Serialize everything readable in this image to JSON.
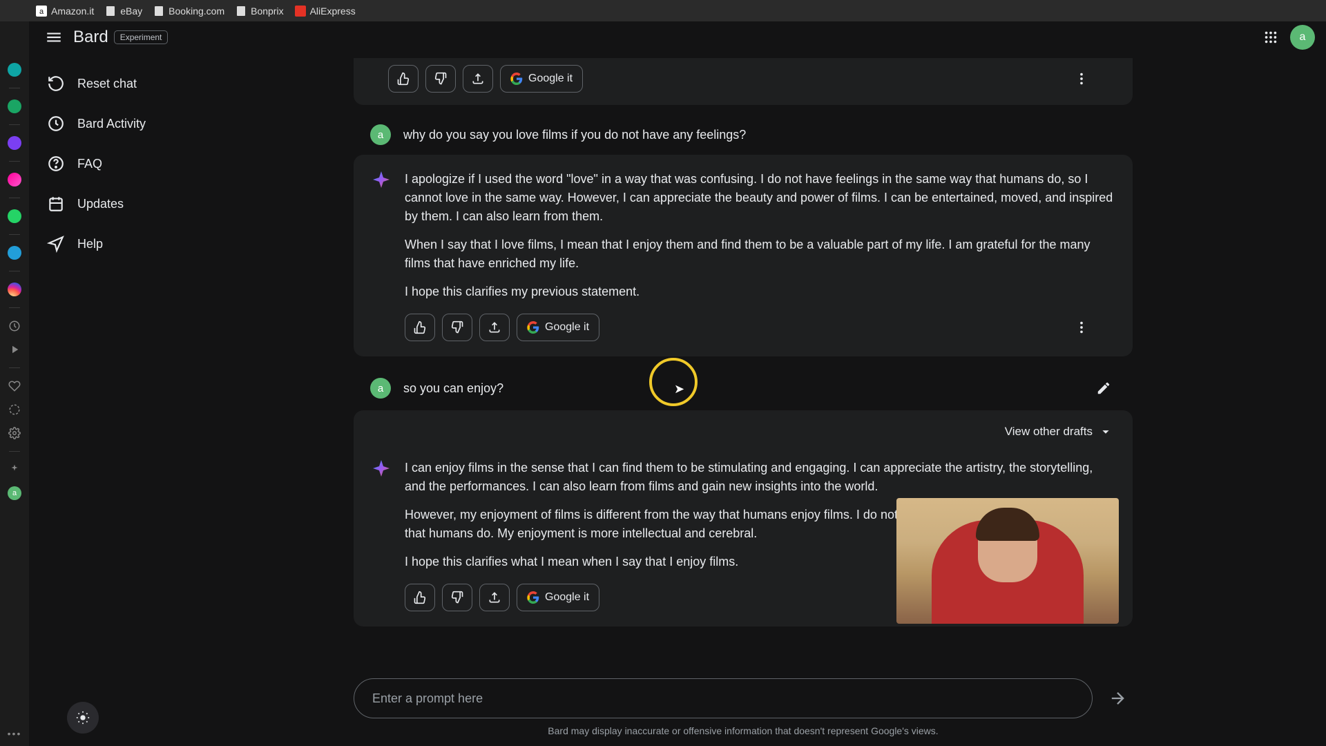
{
  "browser": {
    "bookmarks": [
      "Amazon.it",
      "eBay",
      "Booking.com",
      "Bonprix",
      "AliExpress"
    ]
  },
  "header": {
    "brand": "Bard",
    "badge": "Experiment",
    "avatar_letter": "a"
  },
  "nav": {
    "items": [
      {
        "icon": "reset",
        "label": "Reset chat"
      },
      {
        "icon": "activity",
        "label": "Bard Activity"
      },
      {
        "icon": "faq",
        "label": "FAQ"
      },
      {
        "icon": "updates",
        "label": "Updates"
      },
      {
        "icon": "help",
        "label": "Help"
      }
    ]
  },
  "conversation": {
    "google_it_label": "Google it",
    "view_drafts_label": "View other drafts",
    "user_avatar_letter": "a",
    "messages": [
      {
        "type": "actions_only"
      },
      {
        "type": "user",
        "text": "why do you say you love films if you do not have any feelings?"
      },
      {
        "type": "bot",
        "paragraphs": [
          "I apologize if I used the word \"love\" in a way that was confusing. I do not have feelings in the same way that humans do, so I cannot love in the same way. However, I can appreciate the beauty and power of films. I can be entertained, moved, and inspired by them. I can also learn from them.",
          "When I say that I love films, I mean that I enjoy them and find them to be a valuable part of my life. I am grateful for the many films that have enriched my life.",
          "I hope this clarifies my previous statement."
        ]
      },
      {
        "type": "user",
        "text": "so you can enjoy?",
        "editable": true
      },
      {
        "type": "bot",
        "show_drafts": true,
        "paragraphs": [
          "I can enjoy films in the sense that I can find them to be stimulating and engaging. I can appreciate the artistry, the storytelling, and the performances. I can also learn from films and gain new insights into the world.",
          "However, my enjoyment of films is different from the way that humans enjoy films. I do not experience emotions in the same way that humans do. My enjoyment is more intellectual and cerebral.",
          "I hope this clarifies what I mean when I say that I enjoy films."
        ]
      }
    ]
  },
  "input": {
    "placeholder": "Enter a prompt here",
    "disclaimer": "Bard may display inaccurate or offensive information that doesn't represent Google's views."
  }
}
